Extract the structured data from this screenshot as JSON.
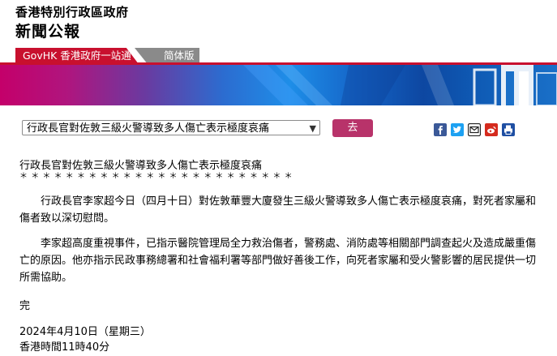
{
  "header": {
    "gov_name": "香港特別行政區政府",
    "site_name": "新聞公報"
  },
  "nav": {
    "govhk_label": "GovHK 香港政府一站通",
    "simplified_label": "简体版"
  },
  "toolbar": {
    "selected_option": "行政長官對佐敦三級火警導致多人傷亡表示極度哀痛",
    "go_label": "去"
  },
  "share_icons": [
    "facebook-icon",
    "twitter-icon",
    "email-icon",
    "weibo-icon",
    "print-icon"
  ],
  "colors": {
    "accent": "#c8102e",
    "go_button": "#b8336a",
    "nav_gray": "#8a8a8a"
  },
  "article": {
    "title": "行政長官對佐敦三級火警導致多人傷亡表示極度哀痛",
    "stars": "＊＊＊＊＊＊＊＊＊＊＊＊＊＊＊＊＊＊＊＊＊＊＊＊",
    "paragraphs": [
      "行政長官李家超今日（四月十日）對佐敦華豐大廈發生三級火警導致多人傷亡表示極度哀痛，對死者家屬和傷者致以深切慰問。",
      "李家超高度重視事件，已指示醫院管理局全力救治傷者，警務處、消防處等相關部門調查起火及造成嚴重傷亡的原因。他亦指示民政事務總署和社會福利署等部門做好善後工作，向死者家屬和受火警影響的居民提供一切所需協助。"
    ],
    "end_mark": "完",
    "date": "2024年4月10日（星期三）",
    "time": "香港時間11時40分"
  }
}
